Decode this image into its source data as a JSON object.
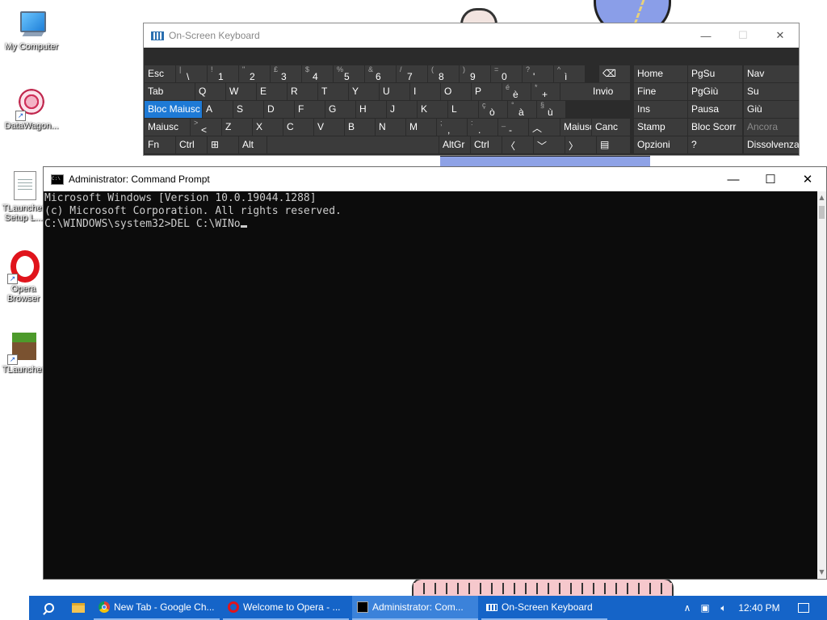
{
  "desktop": {
    "icons": [
      {
        "label": "My Computer",
        "icon": "computer-icon"
      },
      {
        "label": "DataWagon...",
        "icon": "datawagon-icon"
      },
      {
        "label": "TLauncher Setup L...",
        "icon": "document-icon"
      },
      {
        "label": "Opera Browser",
        "icon": "opera-icon"
      },
      {
        "label": "TLauncher",
        "icon": "minecraft-icon"
      }
    ]
  },
  "osk": {
    "title": "On-Screen Keyboard",
    "keys": {
      "esc": "Esc",
      "tab": "Tab",
      "capslock": "Bloc Maiusc",
      "shift_l": "Maiusc",
      "fn": "Fn",
      "ctrl_l": "Ctrl",
      "alt": "Alt",
      "altgr": "AltGr",
      "ctrl_r": "Ctrl",
      "enter": "Invio",
      "shift_r": "Maiusc",
      "canc": "Canc",
      "home": "Home",
      "pgsu": "PgSu",
      "nav": "Nav",
      "fine": "Fine",
      "pggiu": "PgGiù",
      "su": "Su",
      "ins": "Ins",
      "pausa": "Pausa",
      "giu": "Giù",
      "stamp": "Stamp",
      "blocscorr": "Bloc Scorr",
      "ancora": "Ancora",
      "opzioni": "Opzioni",
      "help": "?",
      "dissolvenza": "Dissolvenza",
      "row1": [
        {
          "s": "|",
          "b": "\\"
        },
        {
          "s": "!",
          "b": "1"
        },
        {
          "s": "\"",
          "b": "2"
        },
        {
          "s": "£",
          "b": "3"
        },
        {
          "s": "$",
          "b": "4"
        },
        {
          "s": "%",
          "b": "5"
        },
        {
          "s": "&",
          "b": "6"
        },
        {
          "s": "/",
          "b": "7"
        },
        {
          "s": "(",
          "b": "8"
        },
        {
          "s": ")",
          "b": "9"
        },
        {
          "s": "=",
          "b": "0"
        },
        {
          "s": "?",
          "b": "'"
        },
        {
          "s": "^",
          "b": "ì"
        }
      ],
      "row2": [
        "Q",
        "W",
        "E",
        "R",
        "T",
        "Y",
        "U",
        "I",
        "O",
        "P"
      ],
      "row2_extra": [
        {
          "s": "é",
          "b": "è"
        },
        {
          "s": "*",
          "b": "+"
        }
      ],
      "row3": [
        "A",
        "S",
        "D",
        "F",
        "G",
        "H",
        "J",
        "K",
        "L"
      ],
      "row3_extra": [
        {
          "s": "ç",
          "b": "ò"
        },
        {
          "s": "°",
          "b": "à"
        },
        {
          "s": "§",
          "b": "ù"
        }
      ],
      "row4_lt": {
        "s": ">",
        "b": "<"
      },
      "row4": [
        "Z",
        "X",
        "C",
        "V",
        "B",
        "N",
        "M"
      ],
      "row4_extra": [
        {
          "s": ";",
          "b": ","
        },
        {
          "s": ":",
          "b": "."
        },
        {
          "s": "_",
          "b": "-"
        }
      ]
    }
  },
  "cmd": {
    "title": "Administrator: Command Prompt",
    "lines": [
      "Microsoft Windows [Version 10.0.19044.1288]",
      "(c) Microsoft Corporation. All rights reserved.",
      "",
      "C:\\WINDOWS\\system32>DEL C:\\WINo"
    ]
  },
  "taskbar": {
    "apps": [
      {
        "label": "New Tab - Google Ch...",
        "icon": "chrome-icon"
      },
      {
        "label": "Welcome to Opera - ...",
        "icon": "opera-icon"
      },
      {
        "label": "Administrator: Com...",
        "icon": "cmd-icon"
      },
      {
        "label": "On-Screen Keyboard",
        "icon": "keyboard-icon"
      }
    ],
    "clock": "12:40 PM"
  }
}
